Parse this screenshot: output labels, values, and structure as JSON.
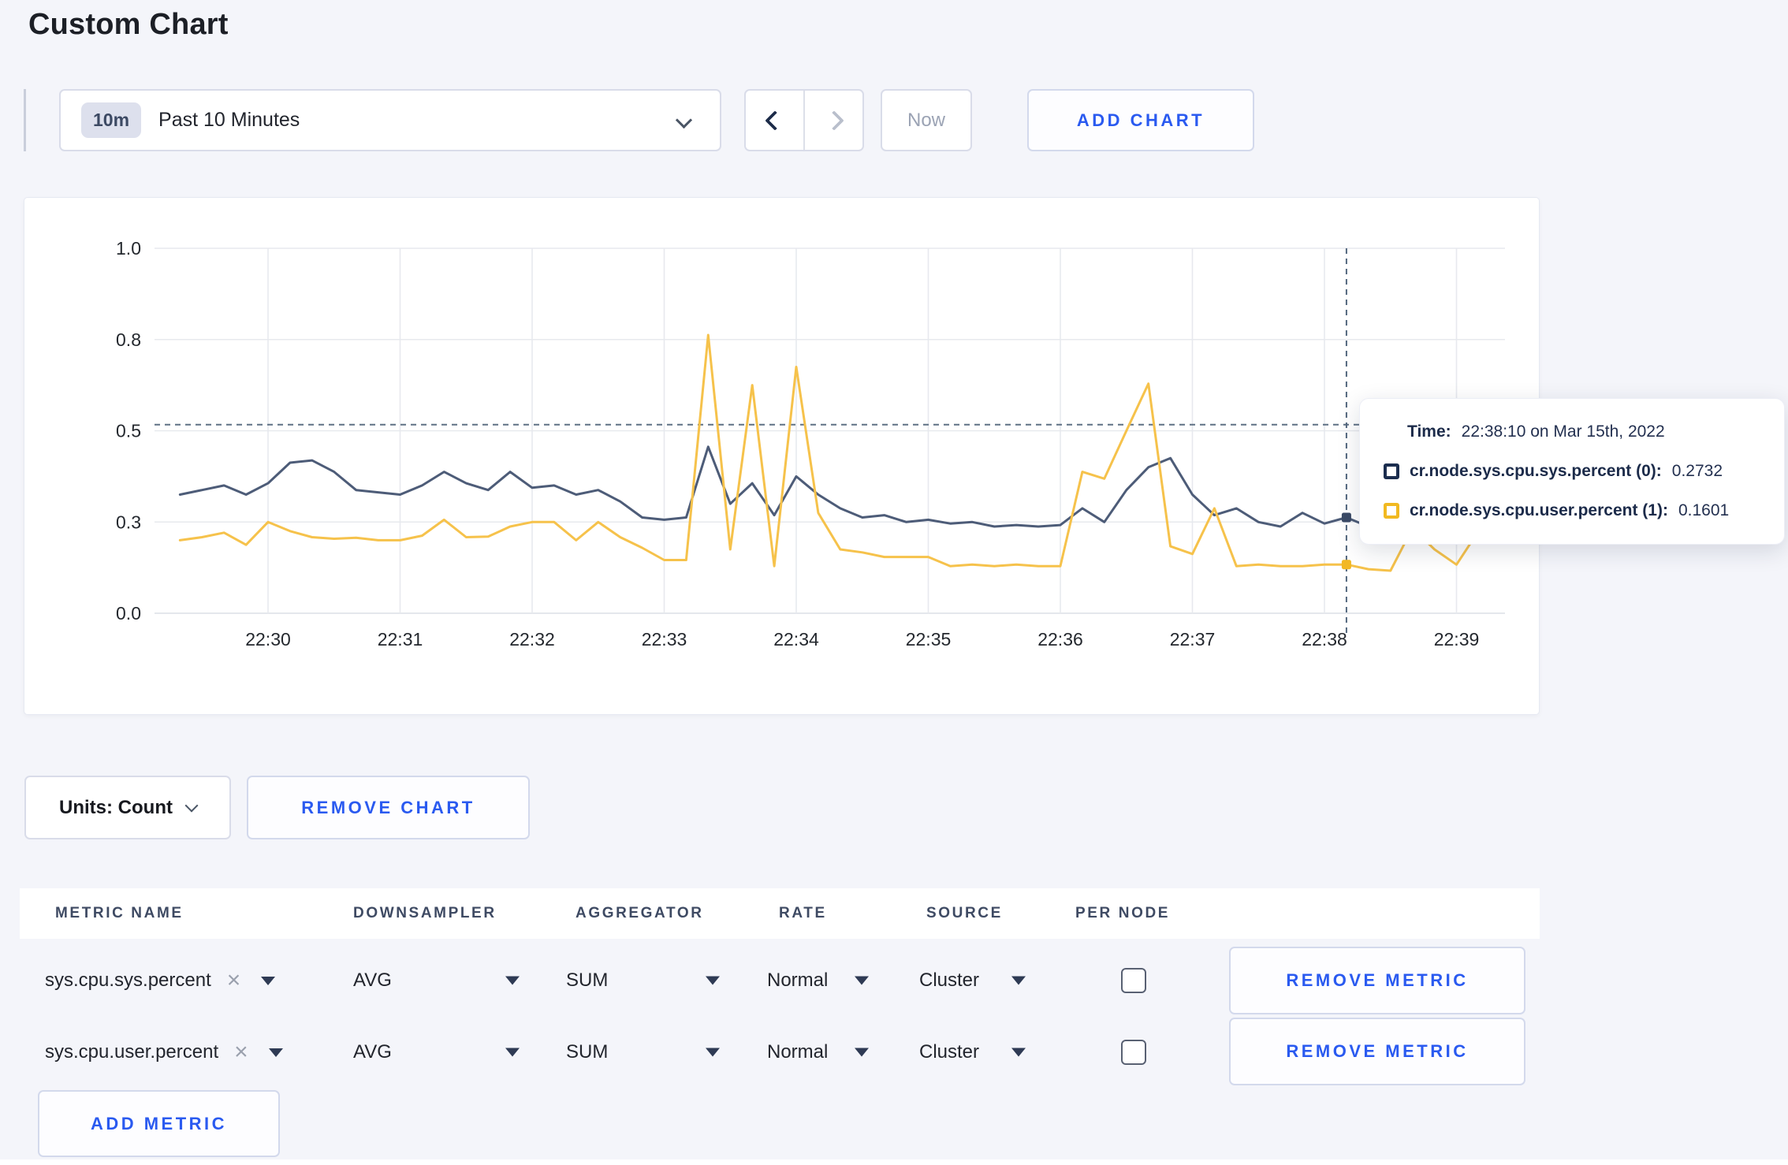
{
  "page": {
    "title": "Custom Chart"
  },
  "toolbar": {
    "time_range": {
      "badge": "10m",
      "label": "Past 10 Minutes"
    },
    "now_label": "Now",
    "add_chart_label": "ADD CHART"
  },
  "chart_data": {
    "type": "line",
    "x_start": "22:29:20",
    "x_step_seconds": 10,
    "x_ticks": [
      "22:30",
      "22:31",
      "22:32",
      "22:33",
      "22:34",
      "22:35",
      "22:36",
      "22:37",
      "22:38",
      "22:39"
    ],
    "y_ticks": [
      "0.0",
      "0.3",
      "0.5",
      "0.8",
      "1.0"
    ],
    "y_tick_values": [
      0,
      0.3,
      0.5,
      0.8,
      1.0
    ],
    "ylim": [
      0,
      1
    ],
    "grid": true,
    "legend_position": "tooltip",
    "series": [
      {
        "name": "cr.node.sys.cpu.sys.percent",
        "color": "#4d5c78",
        "values": [
          0.36,
          0.37,
          0.38,
          0.36,
          0.385,
          0.43,
          0.435,
          0.41,
          0.37,
          0.365,
          0.36,
          0.38,
          0.41,
          0.385,
          0.37,
          0.41,
          0.375,
          0.38,
          0.36,
          0.37,
          0.345,
          0.31,
          0.305,
          0.31,
          0.465,
          0.34,
          0.385,
          0.315,
          0.4,
          0.36,
          0.33,
          0.31,
          0.315,
          0.3,
          0.305,
          0.295,
          0.3,
          0.285,
          0.29,
          0.285,
          0.29,
          0.33,
          0.3,
          0.37,
          0.42,
          0.44,
          0.36,
          0.315,
          0.33,
          0.3,
          0.285,
          0.32,
          0.295,
          0.31,
          0.285,
          0.3,
          0.315,
          0.3,
          0.295,
          0.305
        ]
      },
      {
        "name": "cr.node.sys.cpu.user.percent",
        "color": "#f6c24b",
        "values": [
          0.24,
          0.25,
          0.265,
          0.225,
          0.3,
          0.27,
          0.25,
          0.245,
          0.248,
          0.24,
          0.24,
          0.255,
          0.305,
          0.25,
          0.252,
          0.285,
          0.3,
          0.3,
          0.24,
          0.3,
          0.25,
          0.215,
          0.175,
          0.175,
          0.81,
          0.21,
          0.65,
          0.155,
          0.71,
          0.32,
          0.21,
          0.2,
          0.185,
          0.185,
          0.185,
          0.155,
          0.16,
          0.155,
          0.16,
          0.155,
          0.155,
          0.41,
          0.395,
          0.5,
          0.655,
          0.22,
          0.195,
          0.33,
          0.155,
          0.16,
          0.155,
          0.155,
          0.16,
          0.1601,
          0.145,
          0.14,
          0.28,
          0.21,
          0.16,
          0.27
        ]
      }
    ],
    "crosshair": {
      "time": "22:38:10",
      "seconds_after_22_30": 490,
      "hline_value": 0.52,
      "marker_values": [
        0.31,
        0.1601
      ],
      "marker_colors": [
        "#3a4a66",
        "#f2b824"
      ]
    }
  },
  "tooltip": {
    "time_label": "Time:",
    "time_value": "22:38:10 on Mar 15th, 2022",
    "series": [
      {
        "label": "cr.node.sys.cpu.sys.percent (0):",
        "value": "0.2732",
        "swatch_color": "#1b2d4e"
      },
      {
        "label": "cr.node.sys.cpu.user.percent (1):",
        "value": "0.1601",
        "swatch_color": "#f1b921"
      }
    ]
  },
  "units_bar": {
    "units_label": "Units: Count",
    "remove_chart_label": "REMOVE CHART"
  },
  "metrics_table": {
    "columns": [
      "METRIC NAME",
      "DOWNSAMPLER",
      "AGGREGATOR",
      "RATE",
      "SOURCE",
      "PER NODE"
    ],
    "rows": [
      {
        "name": "sys.cpu.sys.percent",
        "downsampler": "AVG",
        "aggregator": "SUM",
        "rate": "Normal",
        "source": "Cluster",
        "per_node_checked": false
      },
      {
        "name": "sys.cpu.user.percent",
        "downsampler": "AVG",
        "aggregator": "SUM",
        "rate": "Normal",
        "source": "Cluster",
        "per_node_checked": false
      }
    ],
    "remove_metric_label": "REMOVE METRIC",
    "add_metric_label": "ADD METRIC"
  },
  "colors": {
    "accent_blue": "#2a5af0",
    "page_bg": "#f4f5fa",
    "series_sys": "#4d5c78",
    "series_user": "#f6c24b",
    "grid": "#e7e9ee",
    "dashed": "#5e7084"
  }
}
